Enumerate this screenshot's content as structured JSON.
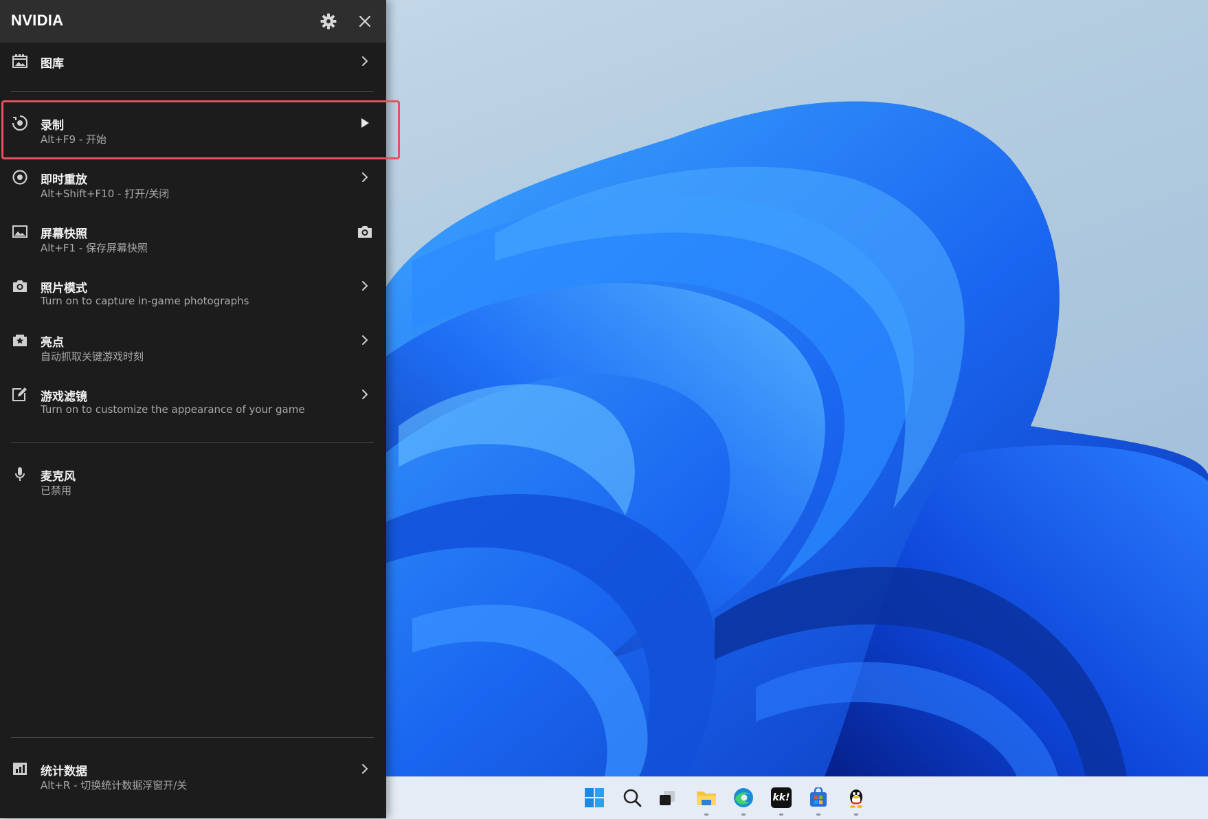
{
  "panel": {
    "brand": "NVIDIA",
    "settings_icon": "gear-icon",
    "close_icon": "close-icon",
    "accent_highlight": "#e8505b",
    "items": [
      {
        "id": "gallery",
        "title": "图库",
        "subtitle": "",
        "icon": "gallery-icon",
        "trail_icon": "chevron-right-icon"
      },
      {
        "id": "record",
        "title": "录制",
        "subtitle": "Alt+F9 - 开始",
        "icon": "record-icon",
        "trail_icon": "play-icon",
        "highlighted": true
      },
      {
        "id": "instant-replay",
        "title": "即时重放",
        "subtitle": "Alt+Shift+F10 - 打开/关闭",
        "icon": "instant-replay-icon",
        "trail_icon": "chevron-right-icon"
      },
      {
        "id": "screenshot",
        "title": "屏幕快照",
        "subtitle": "Alt+F1 - 保存屏幕快照",
        "icon": "image-icon",
        "trail_icon": "camera-icon"
      },
      {
        "id": "photo-mode",
        "title": "照片模式",
        "subtitle": "Turn on to capture in-game photographs",
        "icon": "camera-icon",
        "trail_icon": "chevron-right-icon"
      },
      {
        "id": "highlights",
        "title": "亮点",
        "subtitle": "自动抓取关键游戏时刻",
        "icon": "clapper-star-icon",
        "trail_icon": "chevron-right-icon"
      },
      {
        "id": "game-filter",
        "title": "游戏滤镜",
        "subtitle": "Turn on to customize the appearance of your game",
        "icon": "filter-edit-icon",
        "trail_icon": "chevron-right-icon"
      },
      {
        "id": "microphone",
        "title": "麦克风",
        "subtitle": "已禁用",
        "icon": "microphone-icon",
        "trail_icon": ""
      },
      {
        "id": "statistics",
        "title": "统计数据",
        "subtitle": "Alt+R - 切换统计数据浮窗开/关",
        "icon": "bar-chart-icon",
        "trail_icon": "chevron-right-icon"
      }
    ]
  },
  "taskbar": {
    "apps": [
      {
        "name": "start-button",
        "icon": "windows-logo-icon"
      },
      {
        "name": "search-button",
        "icon": "search-icon"
      },
      {
        "name": "task-view-button",
        "icon": "task-view-icon"
      },
      {
        "name": "file-explorer",
        "icon": "folder-icon",
        "running": true
      },
      {
        "name": "edge-browser",
        "icon": "edge-icon",
        "running": true
      },
      {
        "name": "kk-app",
        "icon": "kk-icon",
        "label": "kk!",
        "running": true
      },
      {
        "name": "ms-store",
        "icon": "store-icon",
        "running": true
      },
      {
        "name": "qq-app",
        "icon": "qq-penguin-icon",
        "running": true
      }
    ]
  }
}
